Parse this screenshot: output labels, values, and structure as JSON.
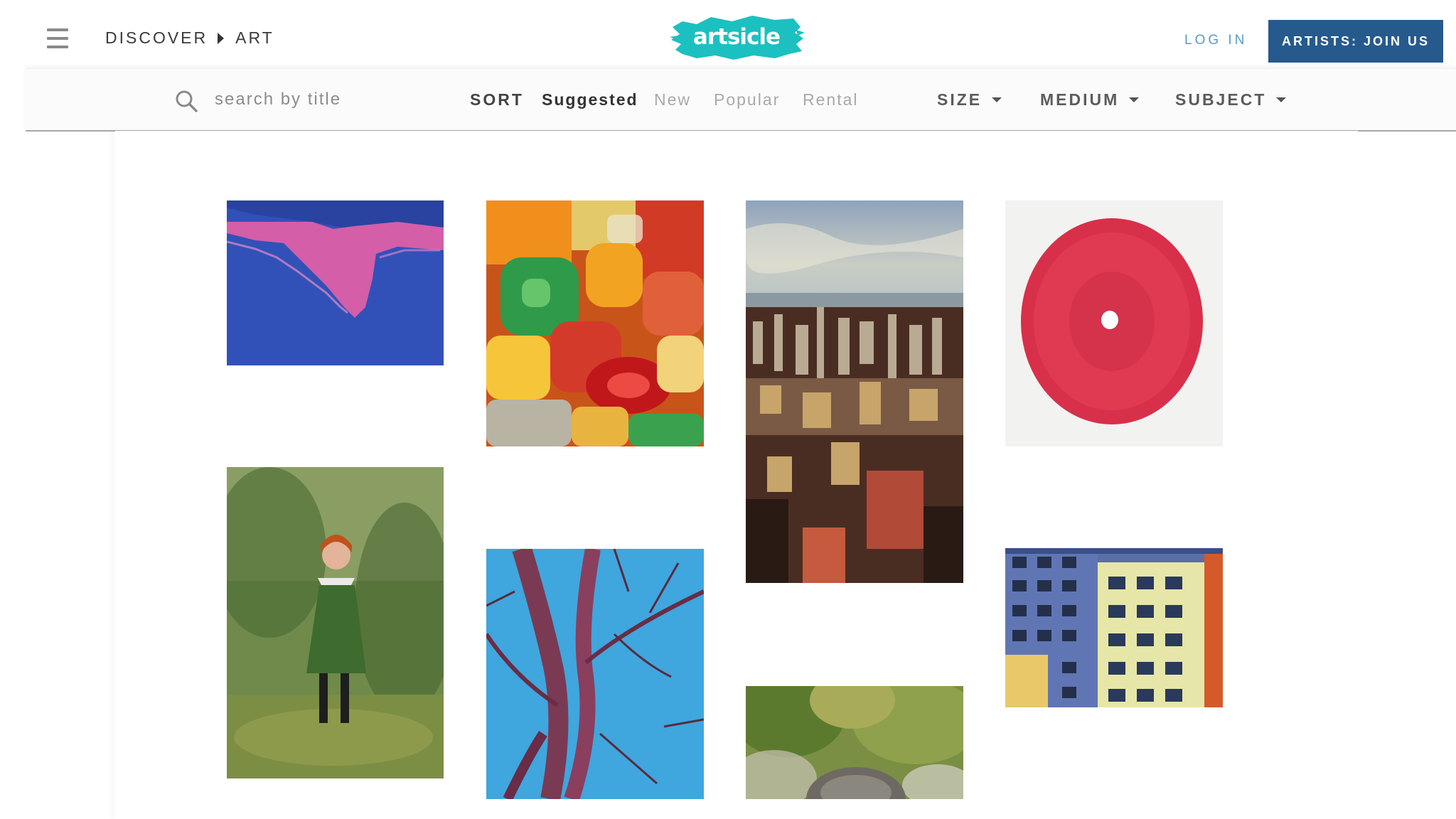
{
  "header": {
    "menu_icon": "hamburger-menu-icon",
    "breadcrumb": [
      "DISCOVER",
      "ART"
    ],
    "logo_text": "artsicle",
    "login_label": "LOG IN",
    "join_label": "ARTISTS: JOIN US"
  },
  "filters": {
    "search_placeholder": "search by title",
    "sort_label": "SORT",
    "sort_options": [
      "Suggested",
      "New",
      "Popular",
      "Rental"
    ],
    "sort_selected": "Suggested",
    "dropdowns": [
      "SIZE",
      "MEDIUM",
      "SUBJECT"
    ]
  },
  "colors": {
    "brand_teal": "#1cc0c0",
    "join_button": "#265a8c",
    "login_link": "#5b9bc4"
  },
  "artworks": [
    {
      "subject": "pink legs on blue"
    },
    {
      "subject": "colorful gummy letters"
    },
    {
      "subject": "city skyline aerial"
    },
    {
      "subject": "red circle drawing"
    },
    {
      "subject": "girl in green coat"
    },
    {
      "subject": "tree branches against blue sky"
    },
    {
      "subject": "tree canopy view"
    },
    {
      "subject": "colorful building facade"
    }
  ]
}
